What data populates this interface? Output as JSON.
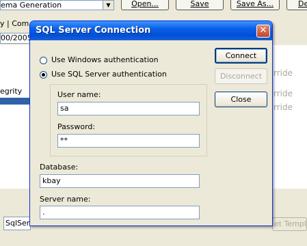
{
  "background": {
    "combo_value": "ema Generation",
    "buttons": {
      "open": "Open...",
      "save": "Save",
      "save_as": "Save As...",
      "de": "De"
    },
    "tabs_text": "y | Com",
    "date_fragment": "00/2005",
    "integrity_fragment": "egrity",
    "override_fragment": "rride",
    "bottom_field": "SqlServ",
    "template_button": "et Templa"
  },
  "dialog": {
    "title": "SQL Server Connection",
    "auth": {
      "windows_label": "Use Windows authentication",
      "sql_label": "Use SQL Server authentication",
      "selected": "sql"
    },
    "user_name": {
      "label": "User name:",
      "value": "sa"
    },
    "password": {
      "label": "Password:",
      "value": "**"
    },
    "database": {
      "label": "Database:",
      "value": "kbay"
    },
    "server_name": {
      "label": "Server name:",
      "value": "."
    },
    "buttons": {
      "connect": "Connect",
      "disconnect": "Disconnect",
      "close": "Close"
    }
  },
  "colors": {
    "titlebar": "#0a5fe6",
    "dialog_face": "#ece9d8",
    "selection": "#3162a8"
  }
}
